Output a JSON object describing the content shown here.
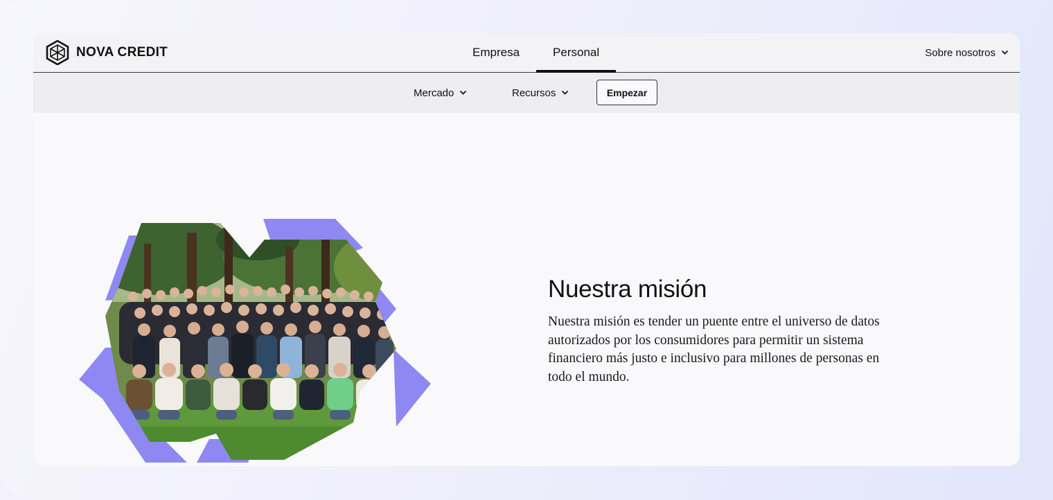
{
  "brand": {
    "name": "NOVA CREDIT",
    "logo_icon": "hexagon-lattice-icon"
  },
  "nav": {
    "tabs": [
      {
        "label": "Empresa",
        "active": false
      },
      {
        "label": "Personal",
        "active": true
      }
    ],
    "about_label": "Sobre nosotros"
  },
  "subnav": {
    "mercado_label": "Mercado",
    "recursos_label": "Recursos",
    "cta_label": "Empezar"
  },
  "mission": {
    "title": "Nuestra misión",
    "body": "Nuestra misión es tender un puente entre el universo de datos autorizados por los consumidores para permitir un sistema financiero más justo e inclusivo para millones de personas en todo el mundo."
  },
  "colors": {
    "accent_purple": "#8f88f2",
    "foliage": "#3f6a30",
    "grass": "#5e9a3c",
    "text": "#111111"
  }
}
